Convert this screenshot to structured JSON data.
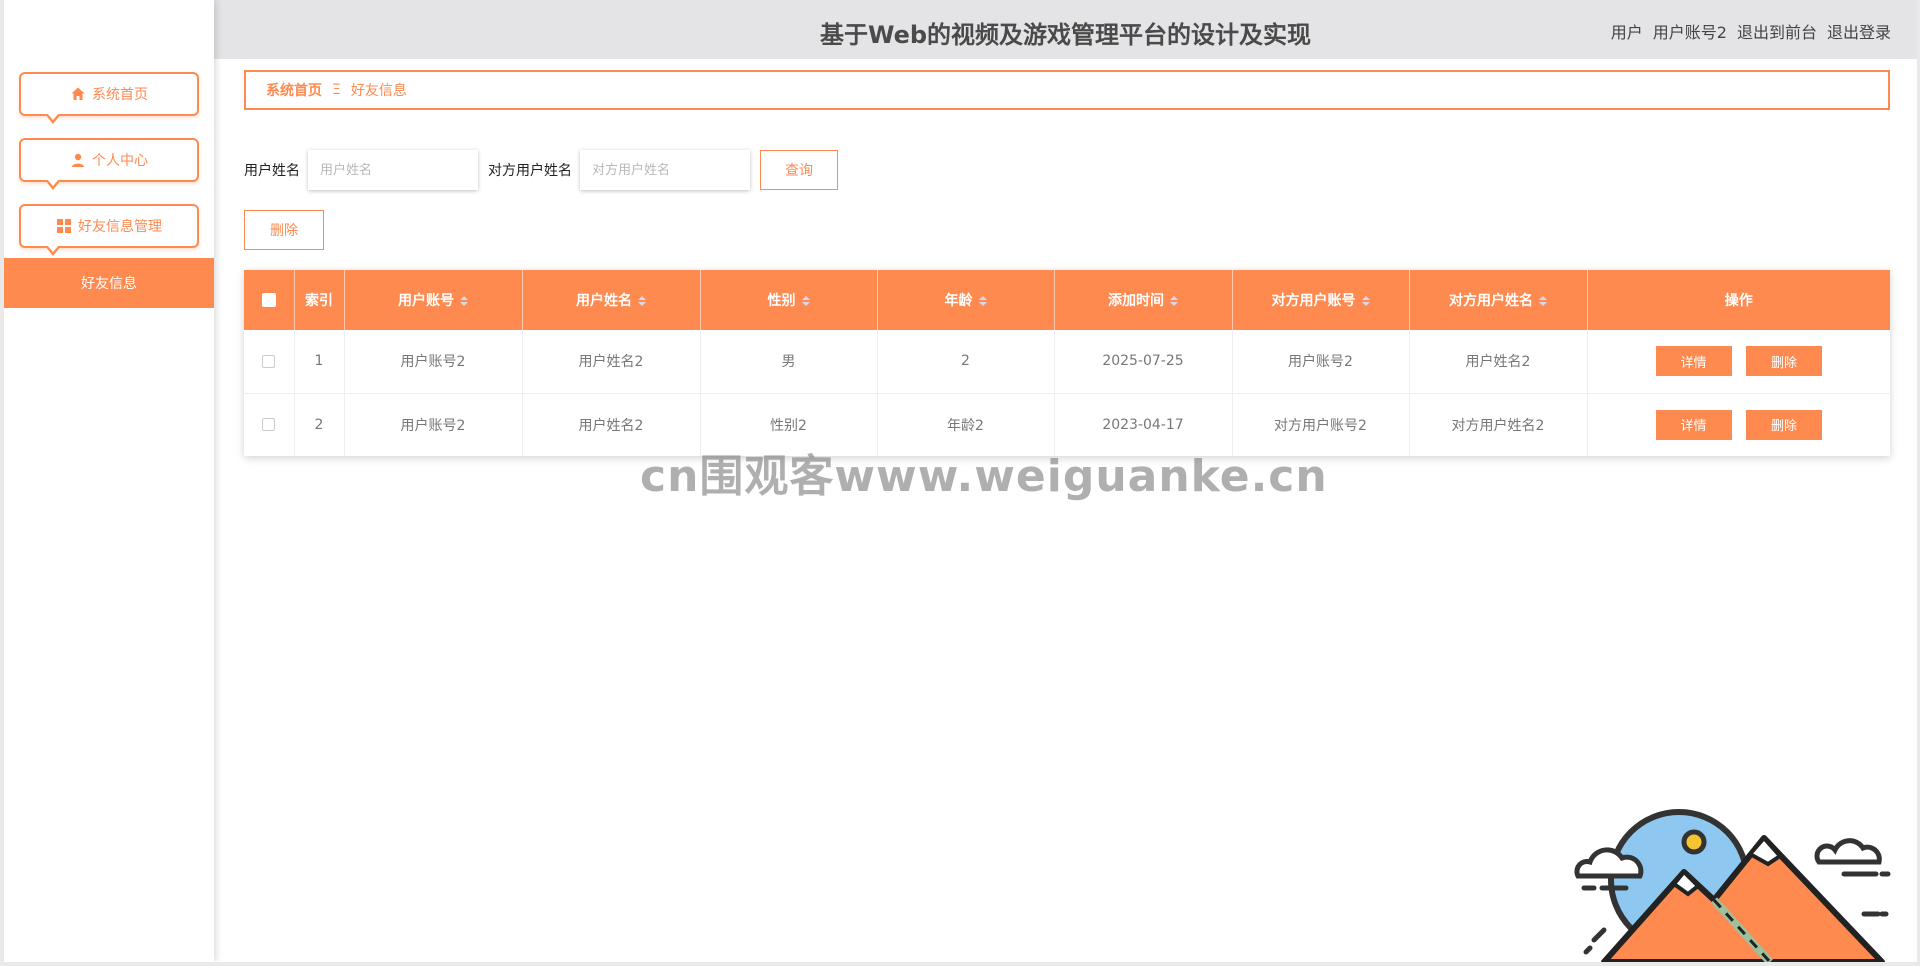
{
  "header": {
    "title": "基于Web的视频及游戏管理平台的设计及实现",
    "user_prefix": "用户",
    "username": "用户账号2",
    "to_front": "退出到前台",
    "logout": "退出登录"
  },
  "sidebar": {
    "items": [
      {
        "label": "系统首页",
        "icon": "home-icon"
      },
      {
        "label": "个人中心",
        "icon": "user-icon"
      },
      {
        "label": "好友信息管理",
        "icon": "grid-icon"
      }
    ],
    "submenu": {
      "label": "好友信息"
    }
  },
  "breadcrumb": {
    "home": "系统首页",
    "separator": "Ξ",
    "current": "好友信息"
  },
  "search": {
    "username_label": "用户姓名",
    "username_placeholder": "用户姓名",
    "other_label": "对方用户姓名",
    "other_placeholder": "对方用户姓名",
    "query_button": "查询"
  },
  "delete_button": "删除",
  "table": {
    "columns": [
      "索引",
      "用户账号",
      "用户姓名",
      "性别",
      "年龄",
      "添加时间",
      "对方用户账号",
      "对方用户姓名",
      "操作"
    ],
    "rows": [
      {
        "index": "1",
        "account": "用户账号2",
        "name": "用户姓名2",
        "gender": "男",
        "age": "2",
        "added": "2025-07-25",
        "other_account": "用户账号2",
        "other_name": "用户姓名2"
      },
      {
        "index": "2",
        "account": "用户账号2",
        "name": "用户姓名2",
        "gender": "性别2",
        "age": "年龄2",
        "added": "2023-04-17",
        "other_account": "对方用户账号2",
        "other_name": "对方用户姓名2"
      }
    ],
    "detail_button": "详情",
    "delete_button": "删除"
  },
  "watermark": "cn围观客www.weiguanke.cn",
  "colors": {
    "accent": "#ff8a50",
    "header_bg": "#e4e4e6"
  }
}
